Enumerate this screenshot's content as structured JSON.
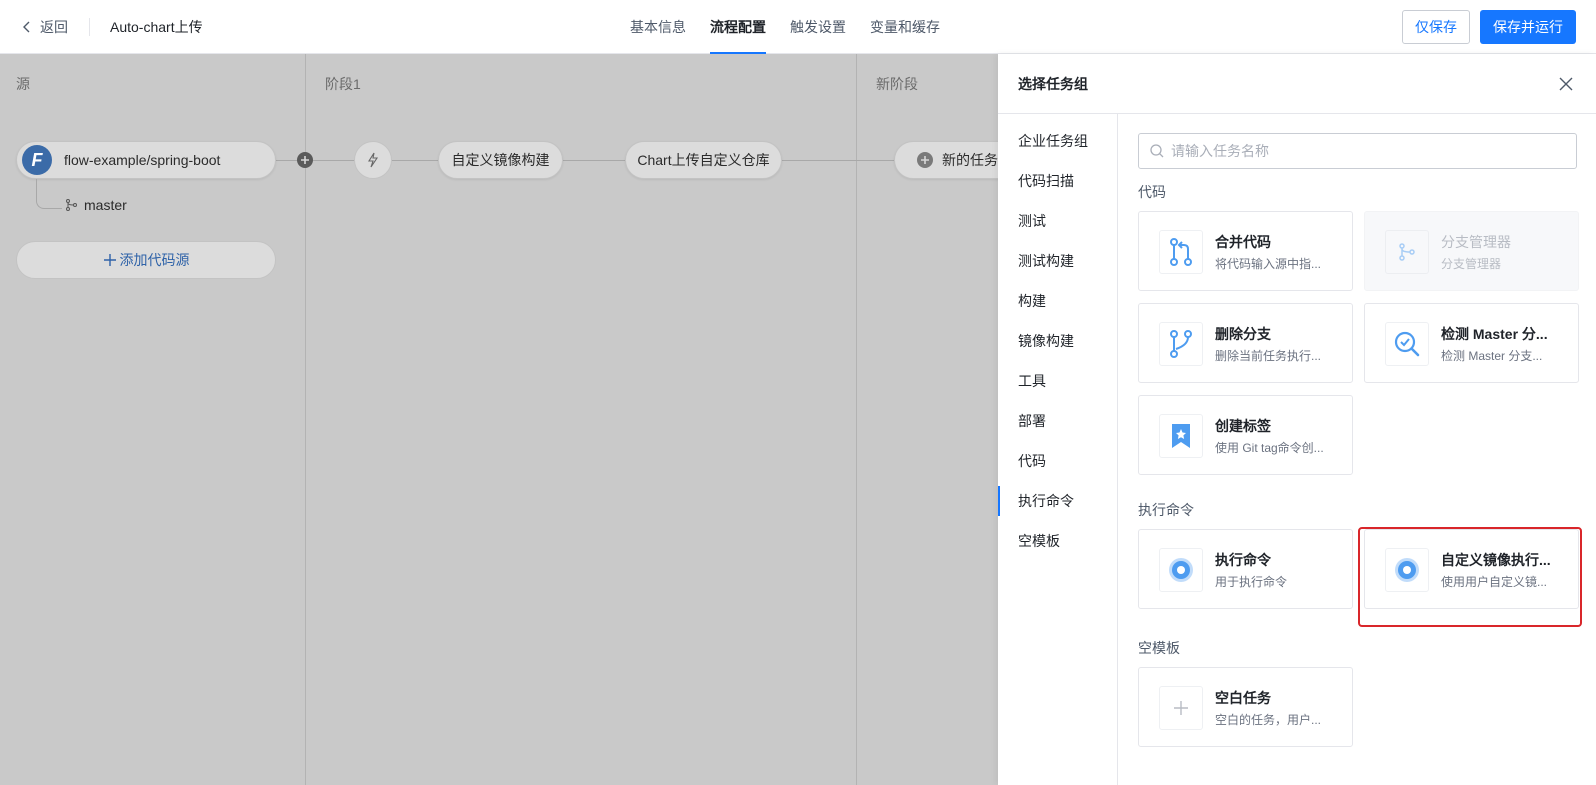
{
  "header": {
    "back_label": "返回",
    "pipeline_name": "Auto-chart上传",
    "tabs": [
      {
        "label": "基本信息",
        "active": false
      },
      {
        "label": "流程配置",
        "active": true
      },
      {
        "label": "触发设置",
        "active": false
      },
      {
        "label": "变量和缓存",
        "active": false
      }
    ],
    "save_label": "仅保存",
    "save_run_label": "保存并运行"
  },
  "canvas": {
    "columns": [
      {
        "title": "源"
      },
      {
        "title": "阶段1"
      },
      {
        "title": "新阶段"
      }
    ],
    "source": {
      "repo": "flow-example/spring-boot",
      "logo_letter": "F",
      "branch": "master"
    },
    "add_source_label": "添加代码源",
    "stage1_tasks": [
      "自定义镜像构建",
      "Chart上传自定义仓库"
    ],
    "new_task_label": "新的任务"
  },
  "drawer": {
    "title": "选择任务组",
    "categories": [
      {
        "label": "企业任务组",
        "active": false
      },
      {
        "label": "代码扫描",
        "active": false
      },
      {
        "label": "测试",
        "active": false
      },
      {
        "label": "测试构建",
        "active": false
      },
      {
        "label": "构建",
        "active": false
      },
      {
        "label": "镜像构建",
        "active": false
      },
      {
        "label": "工具",
        "active": false
      },
      {
        "label": "部署",
        "active": false
      },
      {
        "label": "代码",
        "active": false
      },
      {
        "label": "执行命令",
        "active": true
      },
      {
        "label": "空模板",
        "active": false
      }
    ],
    "search_placeholder": "请输入任务名称",
    "sections": [
      {
        "title": "代码",
        "cards": [
          {
            "name": "合并代码",
            "desc": "将代码输入源中指...",
            "icon": "merge-icon",
            "disabled": false
          },
          {
            "name": "分支管理器",
            "desc": "分支管理器",
            "icon": "branch-icon",
            "disabled": true
          },
          {
            "name": "删除分支",
            "desc": "删除当前任务执行...",
            "icon": "branch-delete-icon",
            "disabled": false
          },
          {
            "name": "检测 Master 分...",
            "desc": "检测 Master 分支...",
            "icon": "check-magnifier-icon",
            "disabled": false
          },
          {
            "name": "创建标签",
            "desc": "使用 Git tag命令创...",
            "icon": "tag-star-icon",
            "disabled": false
          }
        ]
      },
      {
        "title": "执行命令",
        "cards": [
          {
            "name": "执行命令",
            "desc": "用于执行命令",
            "icon": "command-icon",
            "disabled": false
          },
          {
            "name": "自定义镜像执行...",
            "desc": "使用用户自定义镜...",
            "icon": "custom-image-command-icon",
            "disabled": false
          }
        ]
      },
      {
        "title": "空模板",
        "cards": [
          {
            "name": "空白任务",
            "desc": "空白的任务，用户...",
            "icon": "plus-icon",
            "disabled": false
          }
        ]
      }
    ],
    "colors": {
      "accent": "#1677ff",
      "highlight": "#d9262a",
      "icon_blue": "#4e9cf0"
    }
  }
}
